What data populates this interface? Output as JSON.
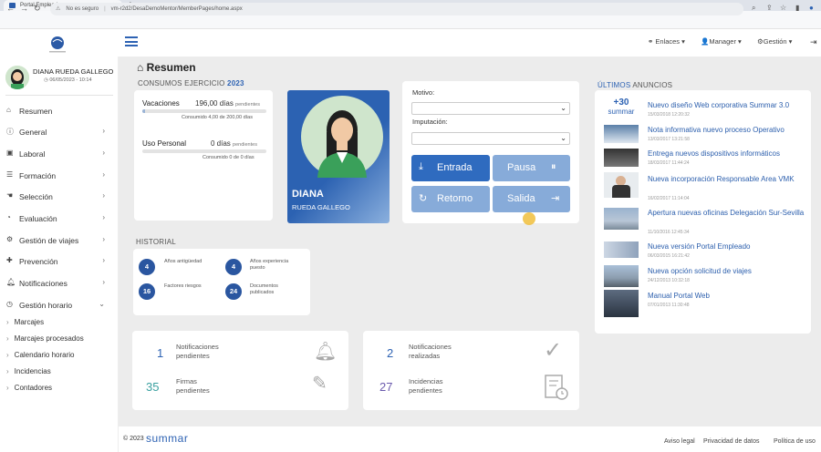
{
  "browser": {
    "tab_title": "Portal Empleado",
    "new_tab": "+",
    "security_text": "No es seguro",
    "url": "vm-r2d2/DesaDemoMentor/MemberPages/home.aspx"
  },
  "header": {
    "nav": [
      "Enlaces",
      "Manager",
      "Gestión"
    ]
  },
  "user": {
    "name": "DIANA RUEDA GALLEGO",
    "date": "06/05/2023 - 10:14"
  },
  "sidebar": {
    "items": [
      {
        "label": "Resumen",
        "icon": "home-icon"
      },
      {
        "label": "General",
        "icon": "info-icon"
      },
      {
        "label": "Laboral",
        "icon": "briefcase-icon"
      },
      {
        "label": "Formación",
        "icon": "book-icon"
      },
      {
        "label": "Selección",
        "icon": "hand-icon"
      },
      {
        "label": "Evaluación",
        "icon": "chart-icon"
      },
      {
        "label": "Gestión de viajes",
        "icon": "gear-icon"
      },
      {
        "label": "Prevención",
        "icon": "shield-icon"
      },
      {
        "label": "Notificaciones",
        "icon": "bell-icon"
      },
      {
        "label": "Gestión horario",
        "icon": "clock-icon"
      }
    ],
    "subitems": [
      "Marcajes",
      "Marcajes procesados",
      "Calendario horario",
      "Incidencias",
      "Contadores"
    ]
  },
  "page": {
    "title": "Resumen"
  },
  "consumos": {
    "label": "CONSUMOS EJERCICIO",
    "year": "2023",
    "vacaciones_label": "Vacaciones",
    "vacaciones_value": "196,00 días",
    "vacaciones_suffix": "pendientes",
    "vacaciones_consumed": "Consumido 4,00 de 200,00 días",
    "vacaciones_progress": 0.02,
    "personal_label": "Uso Personal",
    "personal_value": "0 días",
    "personal_suffix": "pendientes",
    "personal_consumed": "Consumido 0 de 0 días",
    "personal_progress": 0
  },
  "profile": {
    "first": "DIANA",
    "last": "RUEDA GALLEGO"
  },
  "clock": {
    "motivo_label": "Motivo:",
    "imputacion_label": "Imputación:",
    "entrada": "Entrada",
    "pausa": "Pausa",
    "retorno": "Retorno",
    "salida": "Salida"
  },
  "historial": {
    "label": "HISTORIAL",
    "items": [
      {
        "value": "4",
        "text": "Años antigüedad"
      },
      {
        "value": "4",
        "text": "Años experiencia puesto"
      },
      {
        "value": "16",
        "text": "Factores riesgos"
      },
      {
        "value": "24",
        "text": "Documentos publicados"
      }
    ]
  },
  "stats": {
    "notif_pend_value": "1",
    "notif_pend_label": "Notificaciones pendientes",
    "firmas_value": "35",
    "firmas_label": "Firmas pendientes",
    "notif_real_value": "2",
    "notif_real_label": "Notificaciones realizadas",
    "incid_value": "27",
    "incid_label": "Incidencias pendientes"
  },
  "anuncios": {
    "label_a": "ÚLTIMOS",
    "label_b": "ANUNCIOS",
    "items": [
      {
        "title": "Nuevo diseño Web corporativa Summar 3.0",
        "date": "15/03/2018 12:20:32"
      },
      {
        "title": "Nota informativa nuevo proceso Operativo",
        "date": "13/03/2017 13:21:58"
      },
      {
        "title": "Entrega nuevos dispositivos informáticos",
        "date": "18/03/2017 11:44:24"
      },
      {
        "title": "Nueva incorporación Responsable Area VMK",
        "date": "16/02/2017 11:14:04"
      },
      {
        "title": "Apertura nuevas oficinas Delegación Sur-Sevilla",
        "date": "11/10/2016 12:45:34"
      },
      {
        "title": "Nueva versión Portal Empleado",
        "date": "06/03/2015 16:21:42"
      },
      {
        "title": "Nueva opción solicitud de viajes",
        "date": "24/12/2013 10:32:18"
      },
      {
        "title": "Manual Portal Web",
        "date": "07/01/2013 11:30:48"
      }
    ],
    "logo_top": "+30",
    "logo_bottom": "summar"
  },
  "footer": {
    "copyright": "© 2023",
    "brand": "summar",
    "links": [
      "Aviso legal",
      "Privacidad de datos",
      "Política de uso"
    ]
  }
}
